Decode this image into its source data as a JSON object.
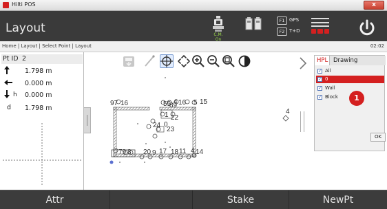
{
  "window": {
    "title": "Hilti POS",
    "close_label": "x"
  },
  "header": {
    "page_title": "Layout",
    "instrument_status": "C.M. On",
    "f1_key": "F1",
    "f1_label": "GPS",
    "f2_key": "F2",
    "f2_label": "T+D"
  },
  "breadcrumb": {
    "path": "Home | Layout | Select Point | Layout",
    "time": "02:02"
  },
  "info_panel": {
    "point_id_label": "Pt ID",
    "point_id": "2",
    "rows": [
      {
        "icon": "arrow-up-icon",
        "label": "",
        "value": "1.798 m"
      },
      {
        "icon": "arrow-left-icon",
        "label": "",
        "value": "0.000 m"
      },
      {
        "icon": "arrow-down-icon",
        "label": "h",
        "value": "0.000 m"
      },
      {
        "icon": "",
        "label": "d",
        "value": "1.798 m"
      }
    ]
  },
  "map": {
    "point_labels": [
      {
        "text": "97"
      },
      {
        "text": "16"
      },
      {
        "text": "55"
      },
      {
        "text": "89"
      },
      {
        "text": "4"
      },
      {
        "text": "16"
      },
      {
        "text": "5"
      },
      {
        "text": "15"
      },
      {
        "text": "1"
      },
      {
        "text": "22"
      },
      {
        "text": "24"
      },
      {
        "text": "0"
      },
      {
        "text": "23"
      },
      {
        "text": "4"
      },
      {
        "text": "79"
      },
      {
        "text": "8"
      },
      {
        "text": "20"
      },
      {
        "text": "9"
      },
      {
        "text": "17"
      },
      {
        "text": "18"
      },
      {
        "text": "11"
      },
      {
        "text": "14"
      },
      {
        "text": "4"
      }
    ]
  },
  "layers": {
    "tab_hpl": "HPL",
    "tab_drawing": "Drawing",
    "items": [
      {
        "label": "All",
        "checked": true,
        "selected": false
      },
      {
        "label": "0",
        "checked": true,
        "selected": true
      },
      {
        "label": "Wall",
        "checked": true,
        "selected": false
      },
      {
        "label": "Block",
        "checked": true,
        "selected": false
      }
    ],
    "callout_number": "1",
    "ok_label": "OK"
  },
  "softkeys": {
    "k1": "Attr",
    "k2": "",
    "k3": "Stake",
    "k4": "NewPt"
  },
  "colors": {
    "accent_red": "#d42020",
    "header_bg": "#3a3a3a",
    "selected_blue": "#2a4fa0"
  }
}
